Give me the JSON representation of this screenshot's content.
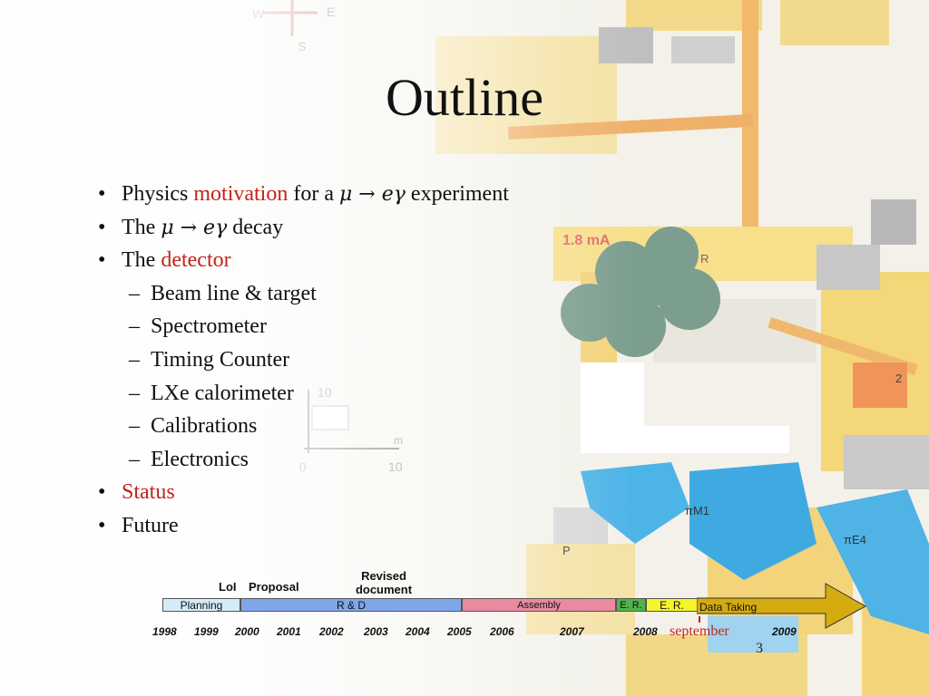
{
  "slide": {
    "title": "Outline",
    "bullets": [
      {
        "level": 1,
        "parts": [
          {
            "text": "Physics "
          },
          {
            "text": "motivation",
            "red": true
          },
          {
            "text": " for a "
          },
          {
            "math": true
          },
          {
            "text": " experiment"
          }
        ]
      },
      {
        "level": 1,
        "parts": [
          {
            "text": "The "
          },
          {
            "math": true
          },
          {
            "text": " decay"
          }
        ]
      },
      {
        "level": 1,
        "parts": [
          {
            "text": "The "
          },
          {
            "text": "detector",
            "red": true
          }
        ]
      },
      {
        "level": 2,
        "parts": [
          {
            "text": "Beam line & target"
          }
        ]
      },
      {
        "level": 2,
        "parts": [
          {
            "text": "Spectrometer"
          }
        ]
      },
      {
        "level": 2,
        "parts": [
          {
            "text": "Timing Counter"
          }
        ]
      },
      {
        "level": 2,
        "parts": [
          {
            "text": "LXe calorimeter"
          }
        ]
      },
      {
        "level": 2,
        "parts": [
          {
            "text": "Calibrations"
          }
        ]
      },
      {
        "level": 2,
        "parts": [
          {
            "text": "Electronics"
          }
        ]
      },
      {
        "level": 1,
        "parts": [
          {
            "text": "Status",
            "red": true
          }
        ]
      },
      {
        "level": 1,
        "parts": [
          {
            "text": "Future"
          }
        ]
      }
    ],
    "math_expr": {
      "mu": "μ",
      "arrow": " → ",
      "e": "e",
      "gamma": "γ"
    },
    "page_number": "3",
    "colors": {
      "accent_red": "#c4231b"
    }
  },
  "timeline": {
    "milestones": [
      "LoI",
      "Proposal",
      "Revised document"
    ],
    "phases": [
      {
        "label": "Planning",
        "color": "#d4ecf7"
      },
      {
        "label": "R & D",
        "color": "#7fa6e8"
      },
      {
        "label": "Assembly",
        "color": "#e88aa0"
      },
      {
        "label": "E. R.",
        "color": "#4fb34a"
      },
      {
        "label": "E. R.",
        "color": "#f4f42a"
      },
      {
        "label": "Data Taking",
        "color": "#d4ac10"
      }
    ],
    "years": [
      "1998",
      "1999",
      "2000",
      "2001",
      "2002",
      "2003",
      "2004",
      "2005",
      "2006",
      "2007",
      "2008",
      "2009"
    ],
    "september_label": "september"
  },
  "map": {
    "labels": [
      "W",
      "E",
      "S",
      "1.8 mA",
      "R",
      "10",
      "0",
      "10",
      "m",
      "πM1",
      "P",
      "2",
      "πE4"
    ]
  }
}
